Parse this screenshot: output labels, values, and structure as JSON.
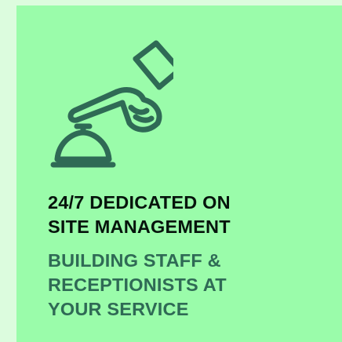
{
  "card": {
    "icon": "hand-pressing-service-bell-icon",
    "headline": [
      "24/7 DEDICATED ON",
      "SITE MANAGEMENT"
    ],
    "subline": [
      "BUILDING STAFF &",
      "RECEPTIONISTS AT",
      "YOUR SERVICE"
    ]
  },
  "colors": {
    "page_background": "#dcfcde",
    "card_background": "#9afcaa",
    "icon_stroke": "#2f6a55",
    "headline_text": "#06140c",
    "subline_text": "#2f6a55"
  }
}
